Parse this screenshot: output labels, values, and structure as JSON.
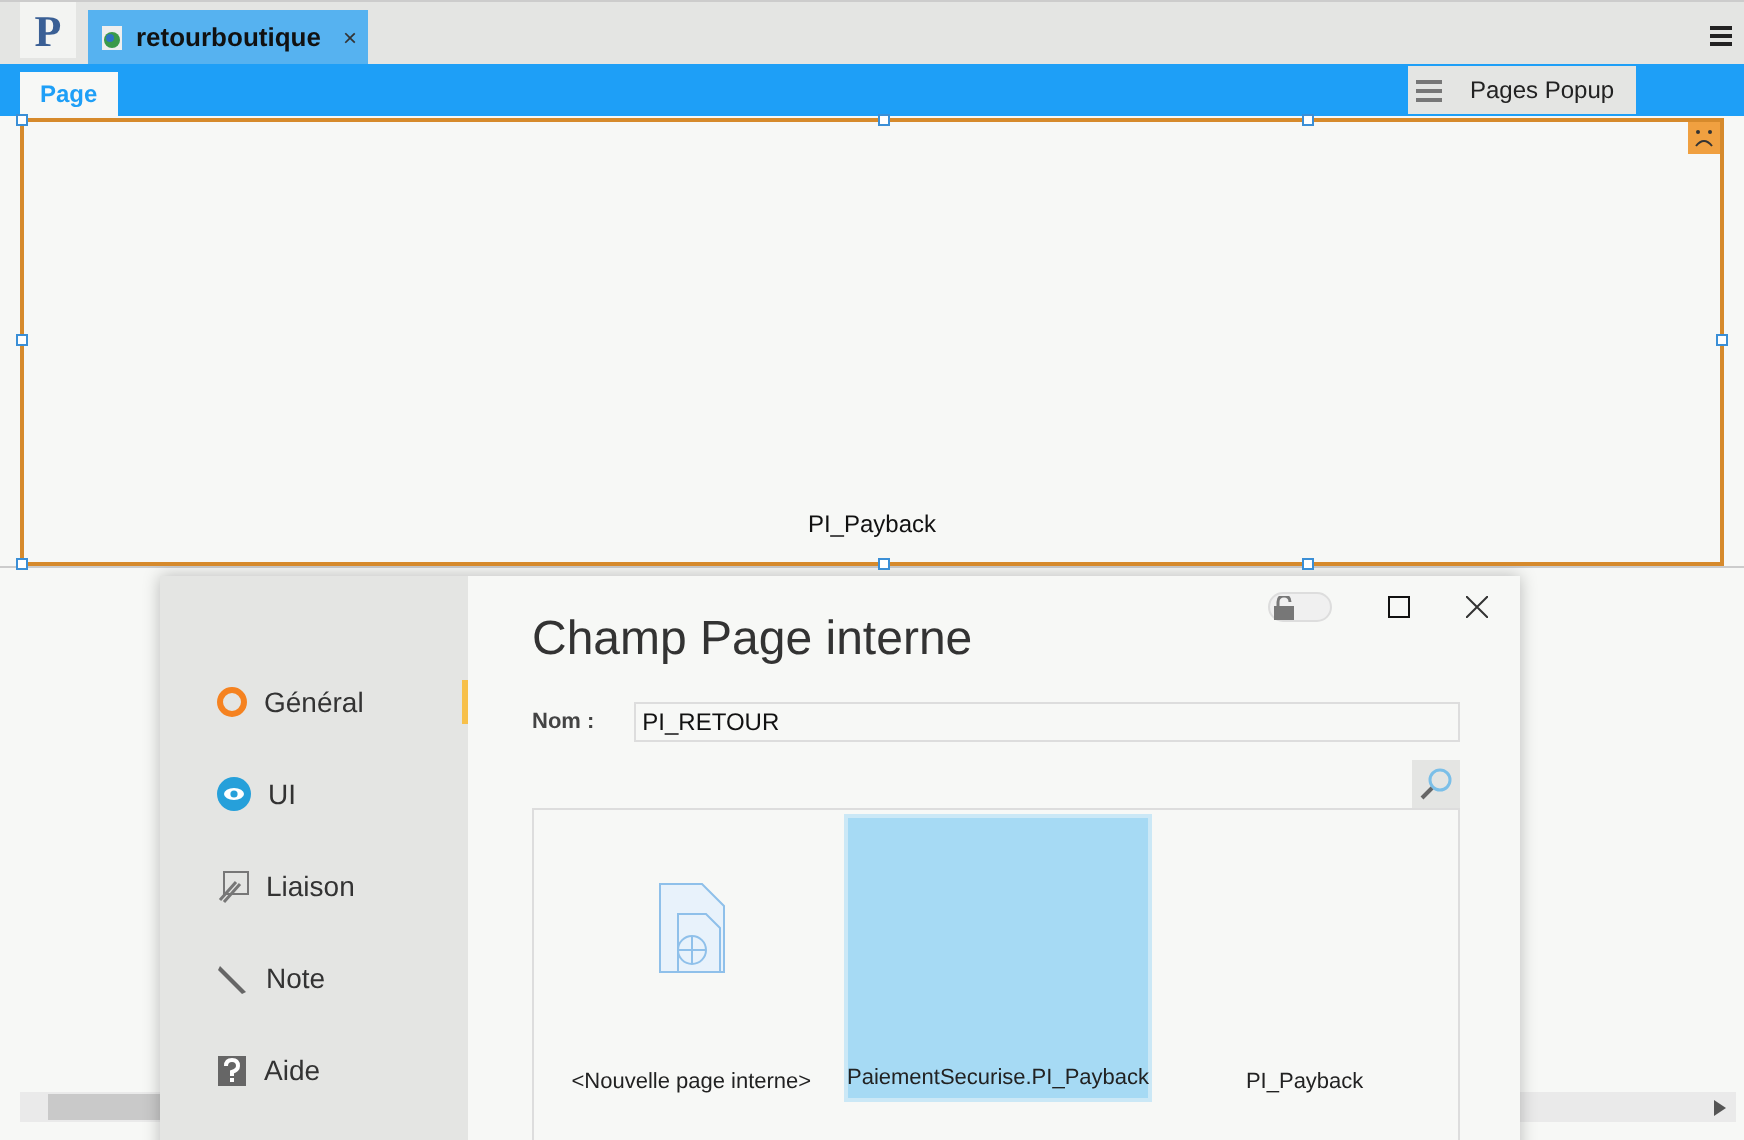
{
  "app": {
    "logo": "P"
  },
  "document_tabs": [
    {
      "label": "retourboutique",
      "selected": true,
      "close": "×"
    }
  ],
  "page_tabs": [
    {
      "label": "Page",
      "selected": true
    }
  ],
  "popup_button": {
    "label": "Pages Popup"
  },
  "canvas": {
    "control_label": "PI_Payback"
  },
  "dialog": {
    "title": "Champ Page interne",
    "lock": {
      "on": false
    },
    "sidebar": [
      {
        "label": "Général",
        "kind": "general",
        "selected": true
      },
      {
        "label": "UI",
        "kind": "ui",
        "selected": false
      },
      {
        "label": "Liaison",
        "kind": "link",
        "selected": false
      },
      {
        "label": "Note",
        "kind": "note",
        "selected": false
      },
      {
        "label": "Aide",
        "kind": "help",
        "selected": false
      }
    ],
    "name_field": {
      "label": "Nom :",
      "value": "PI_RETOUR"
    },
    "pages": [
      {
        "label": "<Nouvelle page interne>",
        "kind": "new",
        "selected": false
      },
      {
        "label": "PaiementSecurise.PI_Payback",
        "kind": "page",
        "selected": true
      },
      {
        "label": "PI_Payback",
        "kind": "page",
        "selected": false
      }
    ]
  }
}
